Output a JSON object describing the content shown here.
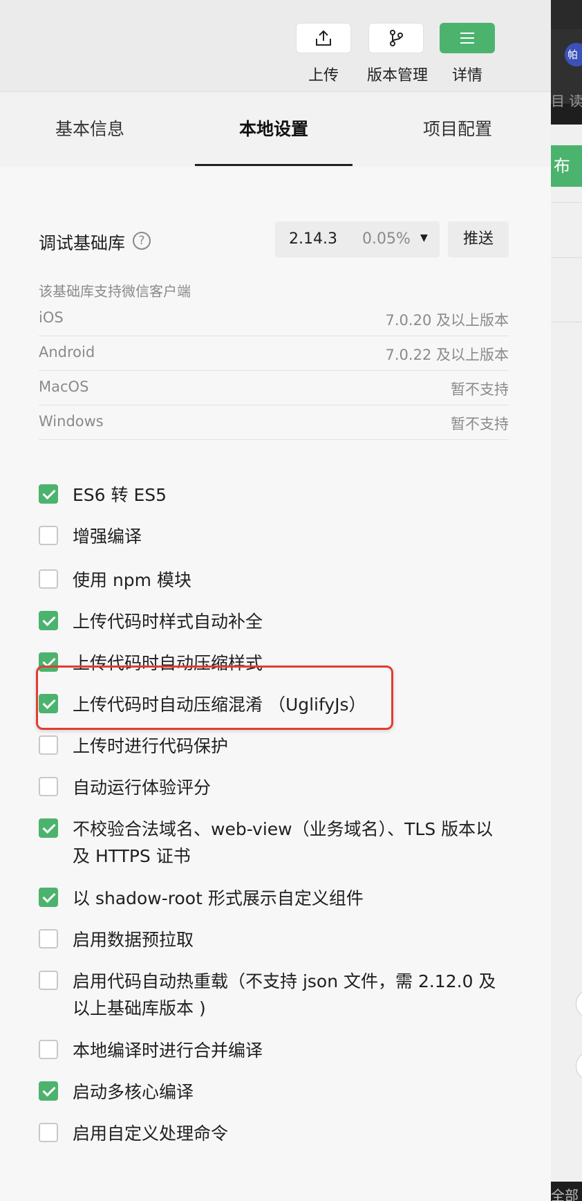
{
  "toolbar": {
    "upload_label": "上传",
    "version_label": "版本管理",
    "details_label": "详情"
  },
  "tabs": [
    {
      "label": "基本信息",
      "active": false
    },
    {
      "label": "本地设置",
      "active": true
    },
    {
      "label": "项目配置",
      "active": false
    }
  ],
  "debug_lib": {
    "title": "调试基础库",
    "help": "?",
    "version": "2.14.3",
    "percent": "0.05%",
    "push_label": "推送"
  },
  "support": {
    "note": "该基础库支持微信客户端",
    "rows": [
      {
        "os": "iOS",
        "value": "7.0.20 及以上版本"
      },
      {
        "os": "Android",
        "value": "7.0.22 及以上版本"
      },
      {
        "os": "MacOS",
        "value": "暂不支持"
      },
      {
        "os": "Windows",
        "value": "暂不支持"
      }
    ]
  },
  "options": [
    {
      "label": "ES6 转 ES5",
      "checked": true
    },
    {
      "label": "增强编译",
      "checked": false
    },
    {
      "label": "使用 npm 模块",
      "checked": false
    },
    {
      "label": "上传代码时样式自动补全",
      "checked": true
    },
    {
      "label": "上传代码时自动压缩样式",
      "checked": true
    },
    {
      "label": "上传代码时自动压缩混淆 （UglifyJs）",
      "checked": true
    },
    {
      "label": "上传时进行代码保护",
      "checked": false
    },
    {
      "label": "自动运行体验评分",
      "checked": false
    },
    {
      "label": "不校验合法域名、web-view（业务域名）、TLS 版本以及 HTTPS 证书",
      "checked": true
    },
    {
      "label": "以 shadow-root 形式展示自定义组件",
      "checked": true
    },
    {
      "label": "启用数据预拉取",
      "checked": false
    },
    {
      "label": "启用代码自动热重载（不支持 json 文件，需 2.12.0 及以上基础库版本 )",
      "checked": false
    },
    {
      "label": "本地编译时进行合并编译",
      "checked": false
    },
    {
      "label": "启动多核心编译",
      "checked": true
    },
    {
      "label": "启用自定义处理命令",
      "checked": false
    }
  ],
  "side": {
    "avatar": "帕",
    "reader": "目 读",
    "publish": "布",
    "all": "全部"
  },
  "colors": {
    "accent": "#4cb36e",
    "highlight": "#e03d33"
  }
}
